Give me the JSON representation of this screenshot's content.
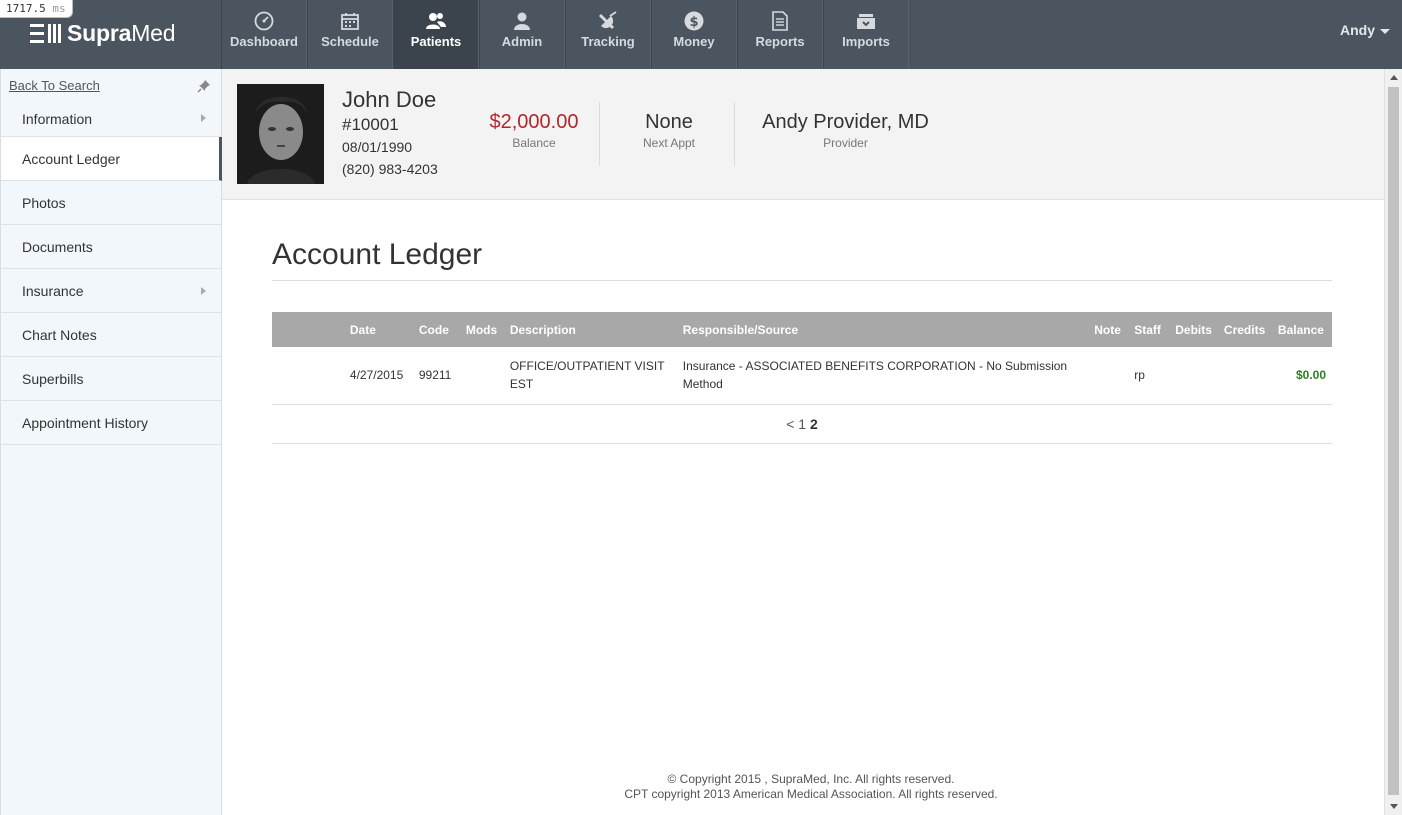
{
  "timer": {
    "value": "1717.5",
    "unit": "ms"
  },
  "app": {
    "logo_bold": "Supra",
    "logo_light": "Med"
  },
  "nav": {
    "items": [
      {
        "label": "Dashboard",
        "icon": "dashboard-icon"
      },
      {
        "label": "Schedule",
        "icon": "calendar-icon"
      },
      {
        "label": "Patients",
        "icon": "patients-icon",
        "active": true
      },
      {
        "label": "Admin",
        "icon": "admin-icon"
      },
      {
        "label": "Tracking",
        "icon": "satellite-icon"
      },
      {
        "label": "Money",
        "icon": "dollar-icon"
      },
      {
        "label": "Reports",
        "icon": "document-icon"
      },
      {
        "label": "Imports",
        "icon": "inbox-icon"
      }
    ],
    "user": "Andy"
  },
  "sidebar": {
    "back_label": "Back To Search",
    "items": [
      {
        "label": "Information"
      },
      {
        "label": "Account Ledger"
      },
      {
        "label": "Photos"
      },
      {
        "label": "Documents"
      },
      {
        "label": "Insurance"
      },
      {
        "label": "Chart Notes"
      },
      {
        "label": "Superbills"
      },
      {
        "label": "Appointment History"
      }
    ]
  },
  "patient": {
    "name": "John Doe",
    "id": "#10001",
    "dob": "08/01/1990",
    "phone": "(820) 983-4203",
    "balance_value": "$2,000.00",
    "balance_label": "Balance",
    "next_appt_value": "None",
    "next_appt_label": "Next Appt",
    "provider_value": "Andy Provider, MD",
    "provider_label": "Provider"
  },
  "ledger": {
    "title": "Account Ledger",
    "columns": [
      "Date",
      "Code",
      "Mods",
      "Description",
      "Responsible/Source",
      "Note",
      "Staff",
      "Debits",
      "Credits",
      "Balance"
    ],
    "rows": [
      {
        "date": "4/27/2015",
        "code": "99211",
        "mods": "",
        "description": "OFFICE/OUTPATIENT VISIT EST",
        "source": "Insurance - ASSOCIATED BENEFITS CORPORATION - No Submission Method",
        "note": "",
        "staff": "rp",
        "debits": "",
        "credits": "",
        "balance": "$0.00"
      }
    ],
    "pager": {
      "prev": "<",
      "page1": "1",
      "page2": "2"
    }
  },
  "footer": {
    "line1": "© Copyright 2015 , SupraMed, Inc. All rights reserved.",
    "line2": "CPT copyright 2013 American Medical Association. All rights reserved."
  },
  "colors": {
    "topbar": "#4a5560",
    "balance_red": "#b0282a",
    "balance_green": "#2e7d22",
    "table_header": "#a8a8a8"
  }
}
